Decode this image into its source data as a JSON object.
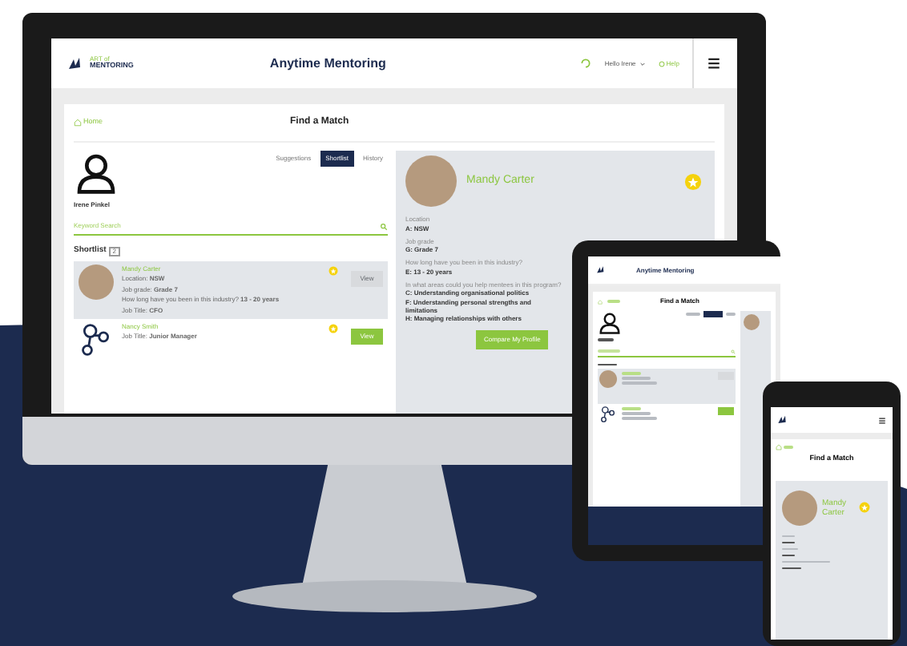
{
  "desktop": {
    "logo": {
      "top": "ART of",
      "bottom": "MENTORING"
    },
    "title": "Anytime Mentoring",
    "greeting": "Hello Irene",
    "help": "Help",
    "home": "Home",
    "page_title": "Find a Match",
    "tabs": [
      {
        "label": "Suggestions",
        "selected": false
      },
      {
        "label": "Shortlist",
        "selected": true
      },
      {
        "label": "History",
        "selected": false
      }
    ],
    "user_name": "Irene Pinkel",
    "search": {
      "placeholder": "Keyword Search"
    },
    "shortlist_heading": "Shortlist",
    "shortlist_count": "2",
    "matches": [
      {
        "name": "Mandy Carter",
        "kind": "photo",
        "selected": true,
        "starred": true,
        "fields": [
          {
            "label": "Location:",
            "value": "NSW"
          },
          {
            "label": "Job grade:",
            "value": "Grade 7"
          },
          {
            "label": "How long have you been in this industry?",
            "value": "13 - 20 years"
          },
          {
            "label": "Job Title:",
            "value": "CFO"
          }
        ],
        "button": "View",
        "button_enabled": false
      },
      {
        "name": "Nancy Smith",
        "kind": "placeholder",
        "selected": false,
        "starred": true,
        "fields": [
          {
            "label": "Job Title:",
            "value": "Junior Manager"
          }
        ],
        "button": "View",
        "button_enabled": true
      }
    ],
    "profile": {
      "name": "Mandy Carter",
      "starred": true,
      "sections": [
        {
          "question": "Location",
          "answers": [
            "A: NSW"
          ]
        },
        {
          "question": "Job grade",
          "answers": [
            "G: Grade 7"
          ]
        },
        {
          "question": "How long have you been in this industry?",
          "answers": [
            "E: 13 - 20 years"
          ]
        },
        {
          "question": "In what areas could you help mentees in this program?",
          "answers": [
            "C: Understanding organisational politics",
            "F: Understanding personal strengths and limitations",
            "H: Managing relationships with others"
          ]
        }
      ],
      "button": "Compare My Profile"
    }
  },
  "tablet": {
    "title": "Anytime Mentoring",
    "page_title": "Find a Match",
    "matches": [
      {
        "kind": "photo",
        "selected": true,
        "button_enabled": false
      },
      {
        "kind": "placeholder",
        "selected": false,
        "button_enabled": true
      }
    ]
  },
  "phone": {
    "page_title": "Find a Match",
    "profile": {
      "name": "Mandy Carter",
      "starred": true
    }
  }
}
